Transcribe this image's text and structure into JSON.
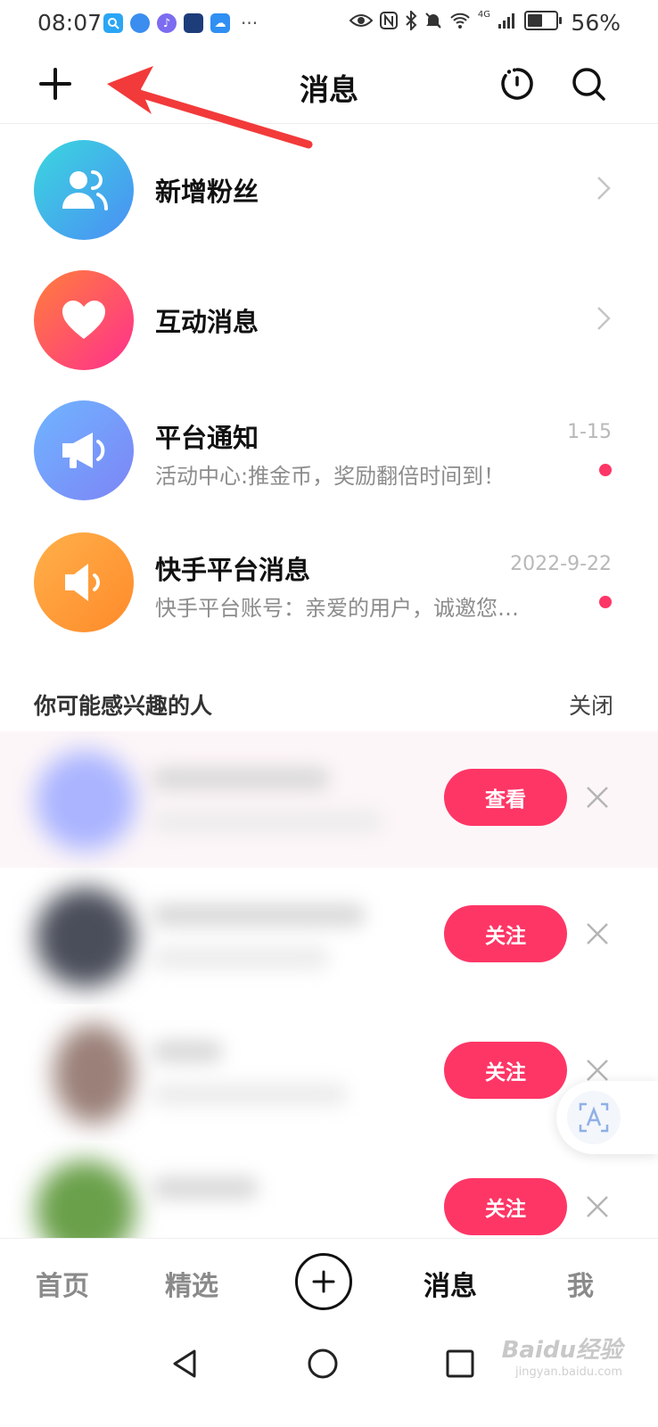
{
  "status_bar": {
    "time": "08:07",
    "more": "···",
    "network": "4G",
    "battery": "56%",
    "battery_level": 0.56
  },
  "header": {
    "title": "消息",
    "icons": [
      "plus-icon",
      "history-icon",
      "search-icon"
    ]
  },
  "messages": [
    {
      "title": "新增粉丝",
      "subtitle": "",
      "date": "",
      "unread": false,
      "color_from": "#3ad7de",
      "color_to": "#4b8ef5",
      "icon": "user-group-icon"
    },
    {
      "title": "互动消息",
      "subtitle": "",
      "date": "",
      "unread": false,
      "color_from": "#ff7f3b",
      "color_to": "#ff2f8e",
      "icon": "heart-icon"
    },
    {
      "title": "平台通知",
      "subtitle": "活动中心:推金币，奖励翻倍时间到！",
      "date": "1-15",
      "unread": true,
      "color_from": "#6fb5ff",
      "color_to": "#7d84f6",
      "icon": "megaphone-icon"
    },
    {
      "title": "快手平台消息",
      "subtitle": "快手平台账号：亲爱的用户，诚邀您…",
      "date": "2022-9-22",
      "unread": true,
      "color_from": "#ffb04a",
      "color_to": "#ff8a2a",
      "icon": "speaker-icon"
    }
  ],
  "suggestions": {
    "heading": "你可能感兴趣的人",
    "close_label": "关闭",
    "people": [
      {
        "action": "查看",
        "avatar_color": "#aab4ff",
        "row_bg": "#fdf6f8"
      },
      {
        "action": "关注",
        "avatar_color": "#4a4e5a",
        "row_bg": "#ffffff"
      },
      {
        "action": "关注",
        "avatar_color": "#9a8078",
        "row_bg": "#ffffff"
      },
      {
        "action": "关注",
        "avatar_color": "#6aa04a",
        "row_bg": "#ffffff"
      }
    ]
  },
  "tabbar": {
    "tabs": [
      "首页",
      "精选",
      "消息",
      "我"
    ],
    "active": "消息"
  },
  "watermark": {
    "brand": "Baidu经验",
    "url": "jingyan.baidu.com"
  },
  "colors": {
    "accent": "#fe3666",
    "arrow": "#f23a3a"
  }
}
